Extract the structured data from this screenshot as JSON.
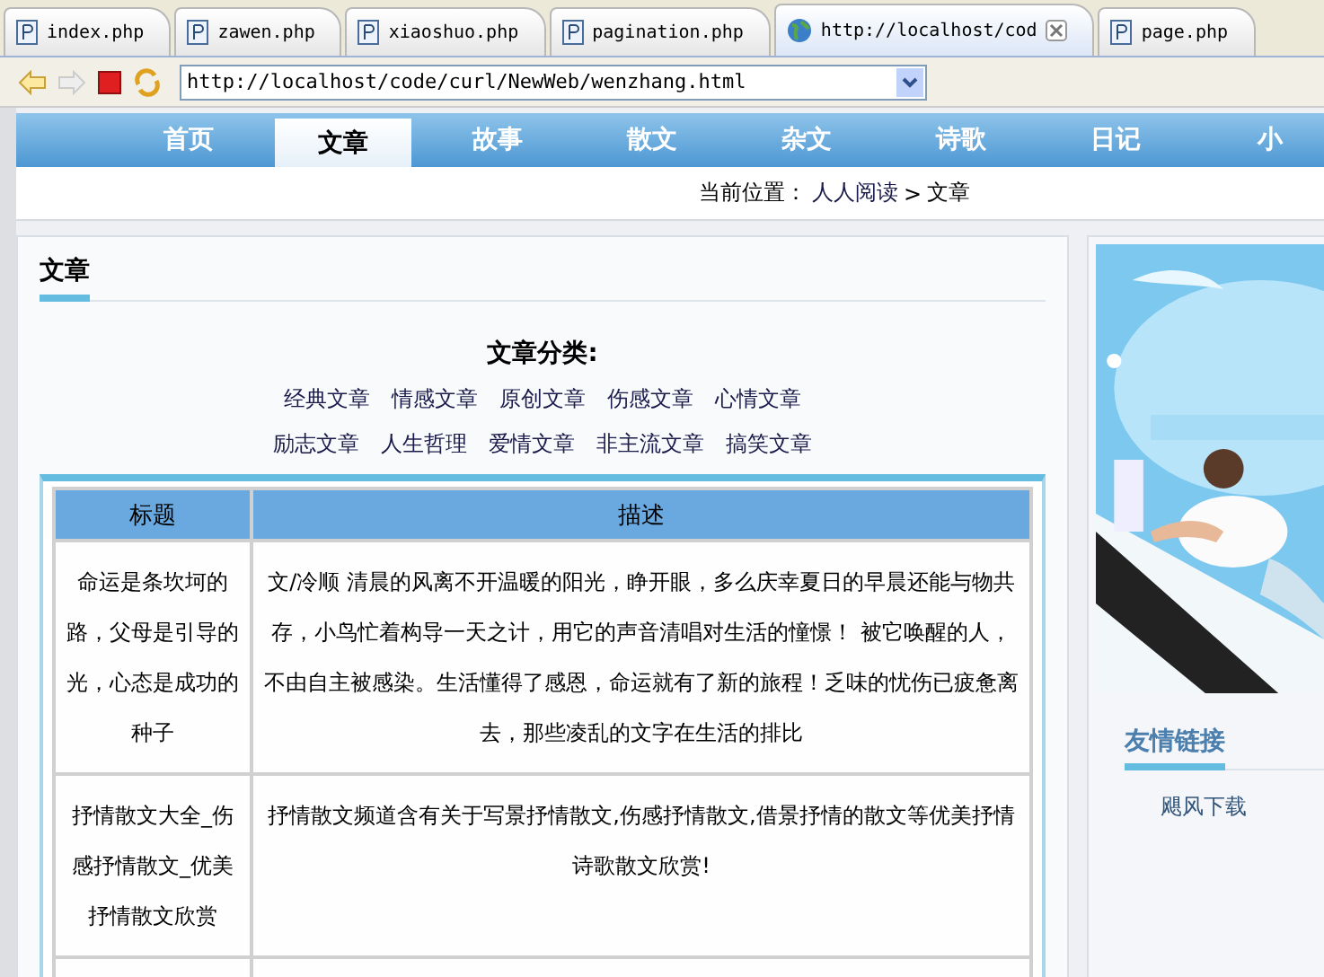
{
  "browser_tabs": [
    {
      "label": "index.php",
      "selected": false
    },
    {
      "label": "zawen.php",
      "selected": false
    },
    {
      "label": "xiaoshuo.php",
      "selected": false
    },
    {
      "label": "pagination.php",
      "selected": false
    },
    {
      "label": "http://localhost/cod",
      "selected": true
    },
    {
      "label": "page.php",
      "selected": false
    }
  ],
  "address_bar": {
    "value": "http://localhost/code/curl/NewWeb/wenzhang.html"
  },
  "nav": [
    {
      "label": "首页",
      "selected": false
    },
    {
      "label": "文章",
      "selected": true
    },
    {
      "label": "故事",
      "selected": false
    },
    {
      "label": "散文",
      "selected": false
    },
    {
      "label": "杂文",
      "selected": false
    },
    {
      "label": "诗歌",
      "selected": false
    },
    {
      "label": "日记",
      "selected": false
    },
    {
      "label": "小",
      "selected": false
    }
  ],
  "breadcrumb": {
    "prefix": "当前位置：",
    "links": [
      "人人阅读"
    ],
    "separator": ">",
    "current": "文章"
  },
  "section_title": "文章",
  "categories": {
    "title": "文章分类:",
    "rows": [
      [
        "经典文章",
        "情感文章",
        "原创文章",
        "伤感文章",
        "心情文章"
      ],
      [
        "励志文章",
        "人生哲理",
        "爱情文章",
        "非主流文章",
        "搞笑文章"
      ]
    ]
  },
  "table": {
    "columns": [
      "标题",
      "描述"
    ],
    "rows": [
      {
        "title": "命运是条坎坷的路，父母是引导的光，心态是成功的种子",
        "description": "文/冷顺 清晨的风离不开温暖的阳光，睁开眼，多么庆幸夏日的早晨还能与物共存，小鸟忙着构导一天之计，用它的声音清唱对生活的憧憬！ 被它唤醒的人，不由自主被感染。生活懂得了感恩，命运就有了新的旅程！乏味的忧伤已疲惫离去，那些凌乱的文字在生活的排比"
      },
      {
        "title": "抒情散文大全_伤感抒情散文_优美抒情散文欣赏",
        "description": "抒情散文频道含有关于写景抒情散文,伤感抒情散文,借景抒情的散文等优美抒情诗歌散文欣赏!"
      }
    ]
  },
  "sidebar": {
    "banner": {
      "kind": "picture"
    },
    "links_title": "友情链接",
    "links": [
      "飓风下载"
    ]
  }
}
